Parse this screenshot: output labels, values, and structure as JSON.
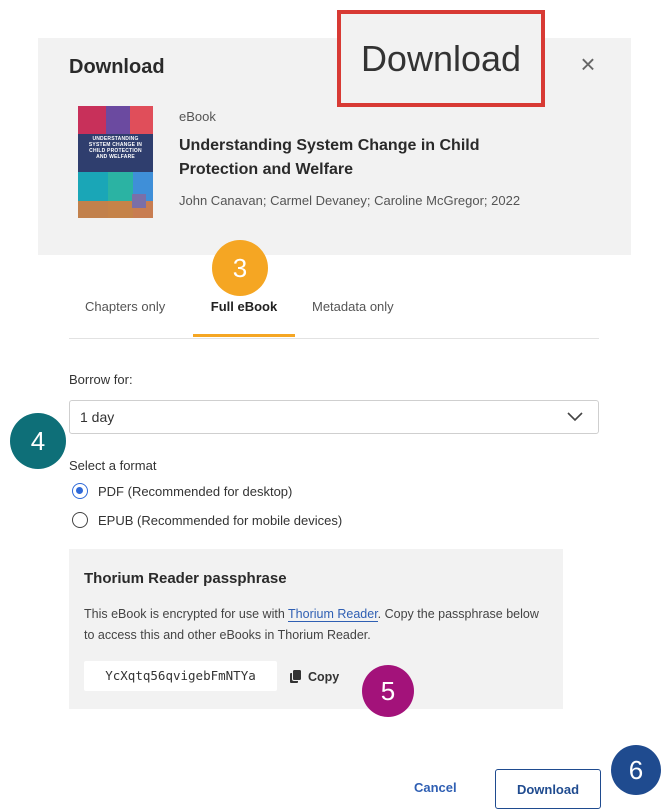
{
  "dialog": {
    "title": "Download",
    "close_icon": "close-icon"
  },
  "callout": {
    "text": "Download",
    "border_color": "#d83a34"
  },
  "book": {
    "type": "eBook",
    "title": "Understanding System Change in Child Protection and Welfare",
    "authors": "John Canavan; Carmel Devaney; Caroline McGregor; 2022",
    "cover_text": "UNDERSTANDING SYSTEM CHANGE IN CHILD PROTECTION AND WELFARE"
  },
  "tabs": [
    {
      "label": "Chapters only",
      "active": false
    },
    {
      "label": "Full eBook",
      "active": true
    },
    {
      "label": "Metadata only",
      "active": false
    }
  ],
  "borrow": {
    "label": "Borrow for:",
    "selected": "1 day"
  },
  "format": {
    "label": "Select a format",
    "options": [
      {
        "label": "PDF (Recommended for desktop)",
        "checked": true
      },
      {
        "label": "EPUB (Recommended for mobile devices)",
        "checked": false
      }
    ]
  },
  "passphrase": {
    "title": "Thorium Reader passphrase",
    "desc_before": "This eBook is encrypted for use with ",
    "link_text": "Thorium Reader",
    "desc_after": ". Copy the passphrase below to access this and other eBooks in Thorium Reader.",
    "code": "YcXqtq56qvigebFmNTYa",
    "copy_label": "Copy"
  },
  "footer": {
    "cancel_label": "Cancel",
    "download_label": "Download"
  },
  "badges": {
    "b3": "3",
    "b4": "4",
    "b5": "5",
    "b6": "6"
  },
  "colors": {
    "accent_tab": "#f5a623",
    "link": "#2f5fb3",
    "primary": "#1f4b8f",
    "badge3": "#f5a623",
    "badge4": "#0e6f78",
    "badge5": "#a3127a",
    "badge6": "#1f4b8f"
  }
}
